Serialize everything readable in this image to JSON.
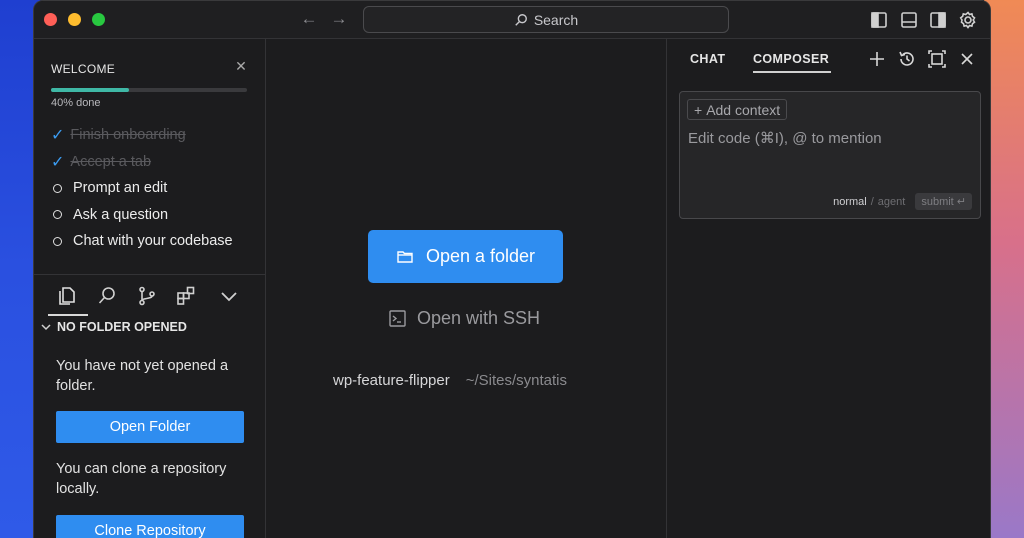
{
  "titlebar": {
    "search_label": "Search"
  },
  "sidebar": {
    "welcome_title": "WELCOME",
    "progress_percent": 40,
    "progress_text": "40% done",
    "checklist": [
      {
        "label": "Finish onboarding",
        "done": true
      },
      {
        "label": "Accept a tab",
        "done": true
      },
      {
        "label": "Prompt an edit",
        "done": false
      },
      {
        "label": "Ask a question",
        "done": false
      },
      {
        "label": "Chat with your codebase",
        "done": false
      }
    ],
    "folder_header": "NO FOLDER OPENED",
    "no_folder_text": "You have not yet opened a folder.",
    "open_folder_label": "Open Folder",
    "clone_text": "You can clone a repository locally.",
    "clone_label": "Clone Repository"
  },
  "editor": {
    "open_folder_label": "Open a folder",
    "ssh_label": "Open with SSH",
    "recent": {
      "name": "wp-feature-flipper",
      "path": "~/Sites/syntatis"
    }
  },
  "chat": {
    "tabs": [
      {
        "label": "CHAT",
        "active": false
      },
      {
        "label": "COMPOSER",
        "active": true
      }
    ],
    "add_context_label": "Add context",
    "placeholder": "Edit code (⌘I), @ to mention",
    "mode_normal": "normal",
    "mode_separator": "/",
    "mode_agent": "agent",
    "submit_label": "submit ↵"
  },
  "colors": {
    "accent_blue": "#2f8df0",
    "progress_teal": "#3fb8a6",
    "check_blue": "#3b9bf0"
  }
}
